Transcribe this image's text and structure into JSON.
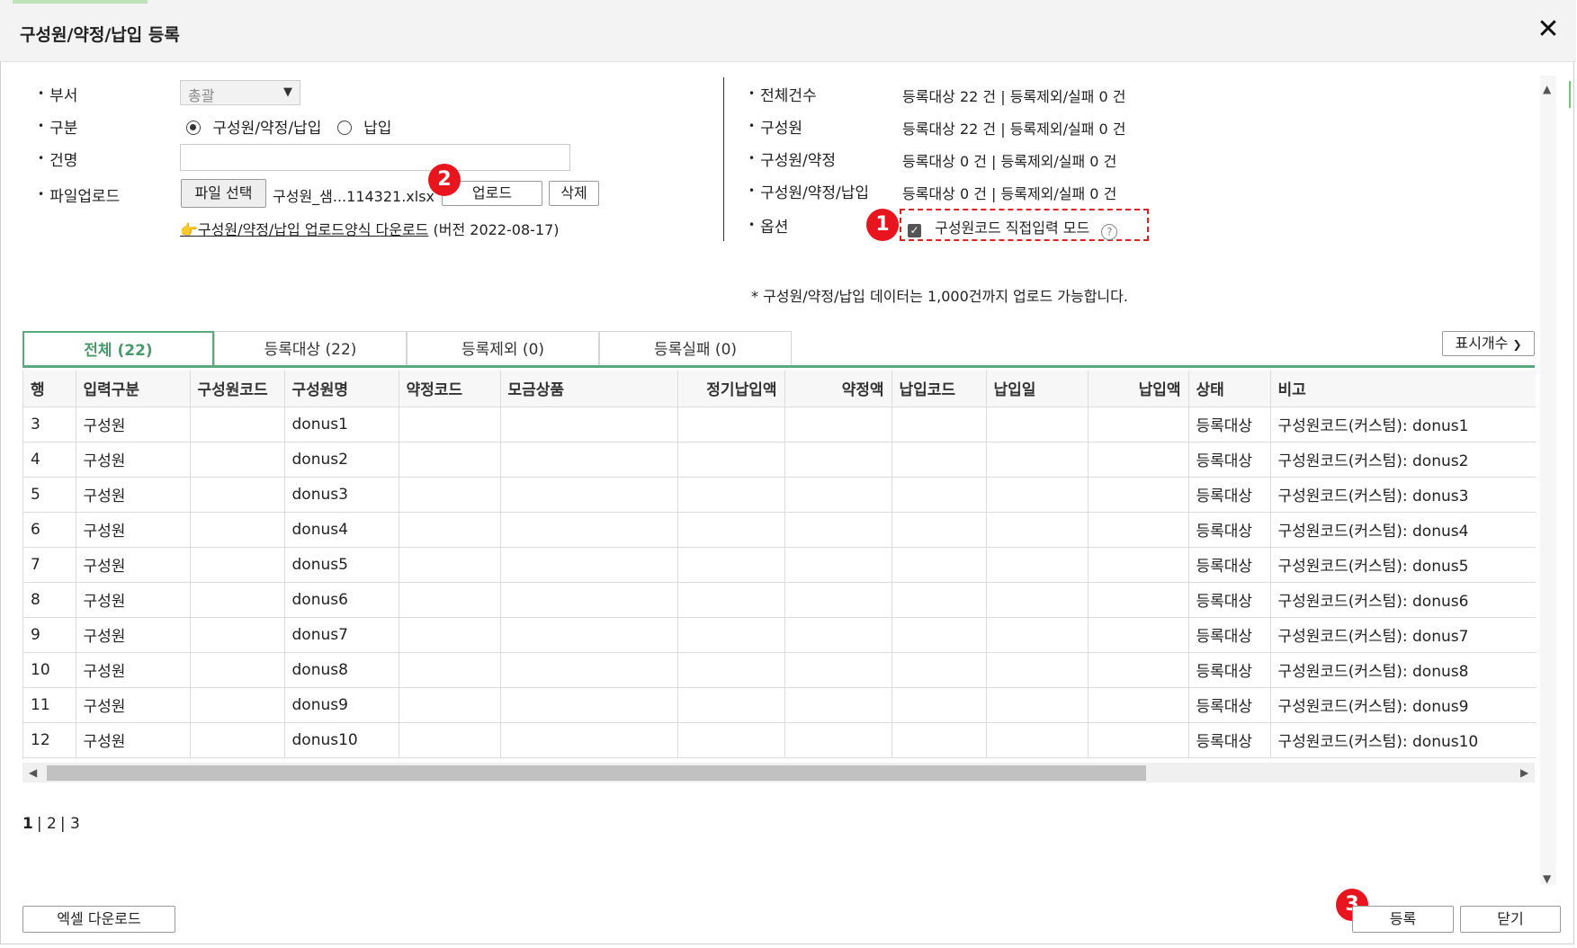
{
  "dialog": {
    "title": "구성원/약정/납입 등록",
    "close_icon": "close-icon"
  },
  "form": {
    "dept_label": "부서",
    "dept_value": "총괄",
    "type_label": "구분",
    "type_options": [
      "구성원/약정/납입",
      "납입"
    ],
    "name_label": "건명",
    "name_value": "",
    "file_label": "파일업로드",
    "file_choose": "파일 선택",
    "file_name": "구성원_샘...114321.xlsx",
    "upload_button": "업로드",
    "delete_button": "삭제",
    "template_link": "👉구성원/약정/납입 업로드양식 다운로드",
    "template_version": "(버전 2022-08-17)"
  },
  "summary": {
    "rows": [
      {
        "label": "전체건수",
        "value": "등록대상 22 건 | 등록제외/실패 0 건"
      },
      {
        "label": "구성원",
        "value": "등록대상 22 건 | 등록제외/실패 0 건"
      },
      {
        "label": "구성원/약정",
        "value": "등록대상 0 건 | 등록제외/실패 0 건"
      },
      {
        "label": "구성원/약정/납입",
        "value": "등록대상 0 건 | 등록제외/실패 0 건"
      }
    ],
    "option_label": "옵션",
    "option_checkbox": "구성원코드 직접입력 모드",
    "option_checked": true,
    "note": "* 구성원/약정/납입 데이터는 1,000건까지 업로드 가능합니다."
  },
  "badges": [
    "1",
    "2",
    "3"
  ],
  "tabs": [
    "전체 (22)",
    "등록대상 (22)",
    "등록제외 (0)",
    "등록실패 (0)"
  ],
  "display_count": "표시개수",
  "table": {
    "headers": [
      "행",
      "입력구분",
      "구성원코드",
      "구성원명",
      "약정코드",
      "모금상품",
      "정기납입액",
      "약정액",
      "납입코드",
      "납입일",
      "납입액",
      "상태",
      "비고"
    ],
    "rows": [
      [
        "3",
        "구성원",
        "",
        "donus1",
        "",
        "",
        "",
        "",
        "",
        "",
        "",
        "등록대상",
        "구성원코드(커스텀): donus1"
      ],
      [
        "4",
        "구성원",
        "",
        "donus2",
        "",
        "",
        "",
        "",
        "",
        "",
        "",
        "등록대상",
        "구성원코드(커스텀): donus2"
      ],
      [
        "5",
        "구성원",
        "",
        "donus3",
        "",
        "",
        "",
        "",
        "",
        "",
        "",
        "등록대상",
        "구성원코드(커스텀): donus3"
      ],
      [
        "6",
        "구성원",
        "",
        "donus4",
        "",
        "",
        "",
        "",
        "",
        "",
        "",
        "등록대상",
        "구성원코드(커스텀): donus4"
      ],
      [
        "7",
        "구성원",
        "",
        "donus5",
        "",
        "",
        "",
        "",
        "",
        "",
        "",
        "등록대상",
        "구성원코드(커스텀): donus5"
      ],
      [
        "8",
        "구성원",
        "",
        "donus6",
        "",
        "",
        "",
        "",
        "",
        "",
        "",
        "등록대상",
        "구성원코드(커스텀): donus6"
      ],
      [
        "9",
        "구성원",
        "",
        "donus7",
        "",
        "",
        "",
        "",
        "",
        "",
        "",
        "등록대상",
        "구성원코드(커스텀): donus7"
      ],
      [
        "10",
        "구성원",
        "",
        "donus8",
        "",
        "",
        "",
        "",
        "",
        "",
        "",
        "등록대상",
        "구성원코드(커스텀): donus8"
      ],
      [
        "11",
        "구성원",
        "",
        "donus9",
        "",
        "",
        "",
        "",
        "",
        "",
        "",
        "등록대상",
        "구성원코드(커스텀): donus9"
      ],
      [
        "12",
        "구성원",
        "",
        "donus10",
        "",
        "",
        "",
        "",
        "",
        "",
        "",
        "등록대상",
        "구성원코드(커스텀): donus10"
      ]
    ]
  },
  "pagination": {
    "current": "1",
    "pages": [
      "2",
      "3"
    ]
  },
  "footer": {
    "excel_button": "엑셀 다운로드",
    "register_button": "등록",
    "close_button": "닫기"
  }
}
